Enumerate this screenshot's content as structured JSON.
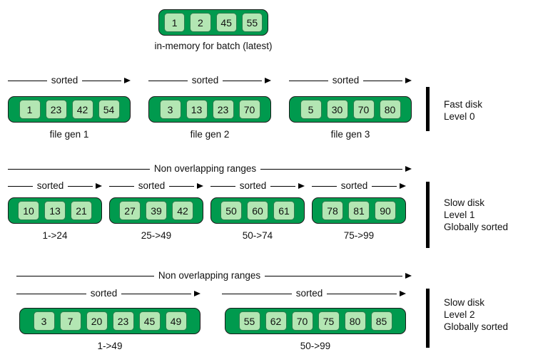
{
  "colors": {
    "run_fill": "#009a4e",
    "cell_fill": "#b3e6b3",
    "outline": "#1a1a1a",
    "text": "#111111",
    "background": "#ffffff"
  },
  "memtable": {
    "caption": "in-memory for batch (latest)",
    "values": [
      "1",
      "2",
      "45",
      "55"
    ]
  },
  "levels": [
    {
      "id": "level-0",
      "description_lines": [
        "Fast disk",
        "Level 0"
      ],
      "span_arrow": null,
      "runs": [
        {
          "label": "file gen 1",
          "arrow_label": "sorted",
          "values": [
            "1",
            "23",
            "42",
            "54"
          ]
        },
        {
          "label": "file gen 2",
          "arrow_label": "sorted",
          "values": [
            "3",
            "13",
            "23",
            "70"
          ]
        },
        {
          "label": "file gen 3",
          "arrow_label": "sorted",
          "values": [
            "5",
            "30",
            "70",
            "80"
          ]
        }
      ]
    },
    {
      "id": "level-1",
      "description_lines": [
        "Slow disk",
        "Level 1",
        "Globally sorted"
      ],
      "span_arrow": "Non overlapping ranges",
      "runs": [
        {
          "label": "1->24",
          "arrow_label": "sorted",
          "values": [
            "10",
            "13",
            "21"
          ]
        },
        {
          "label": "25->49",
          "arrow_label": "sorted",
          "values": [
            "27",
            "39",
            "42"
          ]
        },
        {
          "label": "50->74",
          "arrow_label": "sorted",
          "values": [
            "50",
            "60",
            "61"
          ]
        },
        {
          "label": "75->99",
          "arrow_label": "sorted",
          "values": [
            "78",
            "81",
            "90"
          ]
        }
      ]
    },
    {
      "id": "level-2",
      "description_lines": [
        "Slow disk",
        "Level 2",
        "Globally sorted"
      ],
      "span_arrow": "Non overlapping ranges",
      "runs": [
        {
          "label": "1->49",
          "arrow_label": "sorted",
          "values": [
            "3",
            "7",
            "20",
            "23",
            "45",
            "49"
          ]
        },
        {
          "label": "50->99",
          "arrow_label": "sorted",
          "values": [
            "55",
            "62",
            "70",
            "75",
            "80",
            "85"
          ]
        }
      ]
    }
  ]
}
